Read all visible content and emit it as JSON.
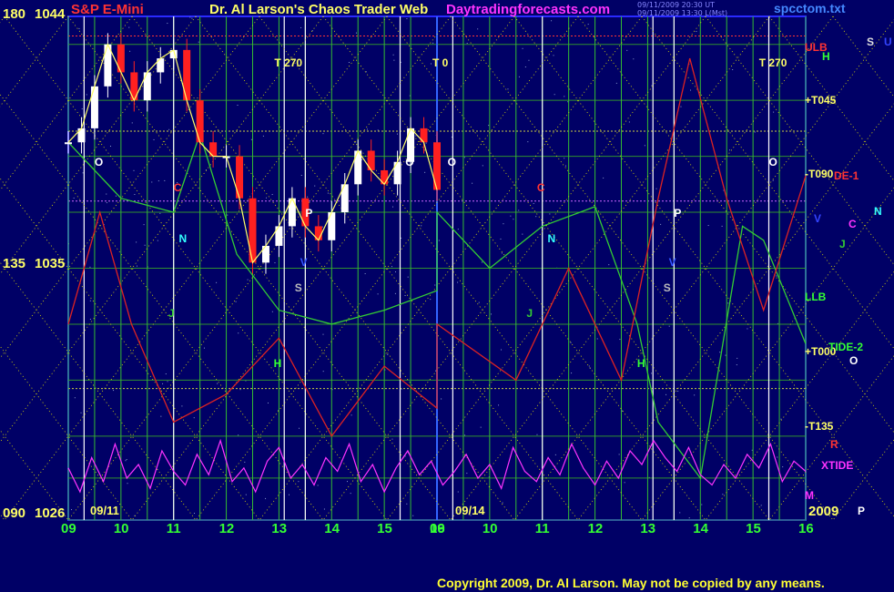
{
  "header": {
    "symbol": "S&P E-Mini",
    "title": "Dr. Al Larson's Chaos Trader Web",
    "website": "Daytradingforecasts.com",
    "timestamp_line1": "09/11/2009 20:30 UT",
    "timestamp_line2": "09/11/2009 13:30 L(Mst)",
    "filename": "spcctom.txt"
  },
  "y_axis_left": [
    {
      "angle": "180",
      "price": "1044"
    },
    {
      "angle": "135",
      "price": "1035"
    },
    {
      "angle": "090",
      "price": "1026"
    }
  ],
  "date_labels": [
    {
      "label": "09/11",
      "day": 0
    },
    {
      "label": "09/14",
      "day": 1
    }
  ],
  "year_label": "2009",
  "hour_ticks": [
    "09",
    "10",
    "11",
    "12",
    "13",
    "14",
    "15",
    "16"
  ],
  "right_labels": {
    "ULB": "ULB",
    "T045": "+T045",
    "T090": "-T090",
    "DE1": "DE-1",
    "LLB": "LLB",
    "T000": "+T000",
    "TIDE2": "TIDE-2",
    "T135": "-T135",
    "R": "R",
    "XTIDE": "XTIDE",
    "M": "M"
  },
  "planet_labels": {
    "S": "S",
    "U": "U",
    "H": "H",
    "V": "V",
    "C": "C",
    "N": "N",
    "J": "J",
    "O": "O",
    "P": "P"
  },
  "t_markers": [
    {
      "label": "T 270",
      "day": 0,
      "hour": 13.0
    },
    {
      "label": "T 0",
      "day": 1,
      "hour": 9.0
    },
    {
      "label": "T 270",
      "day": 1,
      "hour": 15.2
    }
  ],
  "copyright": "Copyright 2009, Dr. Al Larson. May not be copied by any means.",
  "colors": {
    "background": "#000066",
    "grid_green": "#00cc00",
    "grid_yellow": "#e6e600",
    "white_lines": "#ffffff",
    "price_up": "#ffffff",
    "price_down": "#ff2020",
    "tide_red": "#dd2222",
    "tide_green": "#33cc33",
    "xtide_magenta": "#ff33ff"
  },
  "chart_data": {
    "type": "candlestick",
    "title": "S&P E-Mini",
    "ylabel": "",
    "ylim": [
      1026,
      1044
    ],
    "x_sessions": [
      "09/11",
      "09/14"
    ],
    "session_hours": [
      9,
      16
    ],
    "price_series": {
      "name": "S&P E-Mini",
      "points": [
        {
          "day": 0,
          "hour": 9.0,
          "price": 1039.5
        },
        {
          "day": 0,
          "hour": 9.25,
          "price": 1040.0
        },
        {
          "day": 0,
          "hour": 9.5,
          "price": 1041.5
        },
        {
          "day": 0,
          "hour": 9.75,
          "price": 1043.0
        },
        {
          "day": 0,
          "hour": 10.0,
          "price": 1042.0
        },
        {
          "day": 0,
          "hour": 10.25,
          "price": 1041.0
        },
        {
          "day": 0,
          "hour": 10.5,
          "price": 1042.0
        },
        {
          "day": 0,
          "hour": 10.75,
          "price": 1042.5
        },
        {
          "day": 0,
          "hour": 11.0,
          "price": 1042.8
        },
        {
          "day": 0,
          "hour": 11.25,
          "price": 1041.0
        },
        {
          "day": 0,
          "hour": 11.5,
          "price": 1039.5
        },
        {
          "day": 0,
          "hour": 11.75,
          "price": 1039.0
        },
        {
          "day": 0,
          "hour": 12.0,
          "price": 1039.0
        },
        {
          "day": 0,
          "hour": 12.25,
          "price": 1037.5
        },
        {
          "day": 0,
          "hour": 12.5,
          "price": 1035.2
        },
        {
          "day": 0,
          "hour": 12.75,
          "price": 1035.8
        },
        {
          "day": 0,
          "hour": 13.0,
          "price": 1036.5
        },
        {
          "day": 0,
          "hour": 13.25,
          "price": 1037.5
        },
        {
          "day": 0,
          "hour": 13.5,
          "price": 1036.5
        },
        {
          "day": 0,
          "hour": 13.75,
          "price": 1036.0
        },
        {
          "day": 0,
          "hour": 14.0,
          "price": 1037.0
        },
        {
          "day": 0,
          "hour": 14.25,
          "price": 1038.0
        },
        {
          "day": 0,
          "hour": 14.5,
          "price": 1039.2
        },
        {
          "day": 0,
          "hour": 14.75,
          "price": 1038.5
        },
        {
          "day": 0,
          "hour": 15.0,
          "price": 1038.0
        },
        {
          "day": 0,
          "hour": 15.25,
          "price": 1038.8
        },
        {
          "day": 0,
          "hour": 15.5,
          "price": 1040.0
        },
        {
          "day": 0,
          "hour": 15.75,
          "price": 1039.5
        },
        {
          "day": 0,
          "hour": 16.0,
          "price": 1037.8
        }
      ]
    },
    "tide_green": {
      "name": "TIDE-2",
      "points": [
        {
          "day": 0,
          "hour": 9.0,
          "price": 1039.5
        },
        {
          "day": 0,
          "hour": 10.0,
          "price": 1037.5
        },
        {
          "day": 0,
          "hour": 11.0,
          "price": 1037.0
        },
        {
          "day": 0,
          "hour": 11.5,
          "price": 1039.8
        },
        {
          "day": 0,
          "hour": 12.2,
          "price": 1035.5
        },
        {
          "day": 0,
          "hour": 13.0,
          "price": 1033.5
        },
        {
          "day": 0,
          "hour": 14.0,
          "price": 1033.0
        },
        {
          "day": 0,
          "hour": 15.0,
          "price": 1033.5
        },
        {
          "day": 0,
          "hour": 16.0,
          "price": 1034.2
        },
        {
          "day": 1,
          "hour": 9.0,
          "price": 1037.0
        },
        {
          "day": 1,
          "hour": 10.0,
          "price": 1035.0
        },
        {
          "day": 1,
          "hour": 11.0,
          "price": 1036.5
        },
        {
          "day": 1,
          "hour": 12.0,
          "price": 1037.2
        },
        {
          "day": 1,
          "hour": 12.8,
          "price": 1033.0
        },
        {
          "day": 1,
          "hour": 13.2,
          "price": 1029.5
        },
        {
          "day": 1,
          "hour": 14.0,
          "price": 1027.5
        },
        {
          "day": 1,
          "hour": 14.8,
          "price": 1036.5
        },
        {
          "day": 1,
          "hour": 15.2,
          "price": 1036.0
        },
        {
          "day": 1,
          "hour": 16.0,
          "price": 1032.3
        }
      ]
    },
    "tide_red": {
      "name": "DE-1",
      "points": [
        {
          "day": 0,
          "hour": 9.0,
          "price": 1033.0
        },
        {
          "day": 0,
          "hour": 9.6,
          "price": 1037.0
        },
        {
          "day": 0,
          "hour": 10.2,
          "price": 1033.0
        },
        {
          "day": 0,
          "hour": 11.0,
          "price": 1029.5
        },
        {
          "day": 0,
          "hour": 12.0,
          "price": 1030.5
        },
        {
          "day": 0,
          "hour": 13.0,
          "price": 1032.5
        },
        {
          "day": 0,
          "hour": 14.0,
          "price": 1029.0
        },
        {
          "day": 0,
          "hour": 15.0,
          "price": 1031.5
        },
        {
          "day": 0,
          "hour": 16.0,
          "price": 1030.0
        },
        {
          "day": 1,
          "hour": 9.0,
          "price": 1033.0
        },
        {
          "day": 1,
          "hour": 10.5,
          "price": 1031.0
        },
        {
          "day": 1,
          "hour": 11.5,
          "price": 1035.0
        },
        {
          "day": 1,
          "hour": 12.5,
          "price": 1031.0
        },
        {
          "day": 1,
          "hour": 13.2,
          "price": 1037.5
        },
        {
          "day": 1,
          "hour": 13.8,
          "price": 1042.5
        },
        {
          "day": 1,
          "hour": 14.5,
          "price": 1037.5
        },
        {
          "day": 1,
          "hour": 15.2,
          "price": 1033.5
        },
        {
          "day": 1,
          "hour": 16.0,
          "price": 1038.3
        }
      ]
    },
    "xtide": {
      "name": "XTIDE",
      "values": [
        0.55,
        0.2,
        0.7,
        0.35,
        0.9,
        0.4,
        0.6,
        0.25,
        0.8,
        0.5,
        0.3,
        0.75,
        0.45,
        0.95,
        0.35,
        0.55,
        0.2,
        0.65,
        0.85,
        0.4,
        0.6,
        0.3,
        0.7,
        0.5,
        0.9,
        0.35,
        0.6,
        0.2,
        0.55,
        0.8,
        0.45,
        0.65,
        0.3,
        0.5,
        0.75,
        0.4,
        0.6,
        0.25,
        0.85,
        0.5,
        0.35,
        0.7,
        0.45,
        0.9,
        0.55,
        0.3,
        0.65,
        0.4,
        0.8,
        0.6,
        0.95,
        0.7,
        0.5,
        0.85,
        0.45,
        0.3,
        0.6,
        0.4,
        0.75,
        0.55,
        0.9,
        0.35,
        0.65,
        0.5
      ]
    }
  }
}
